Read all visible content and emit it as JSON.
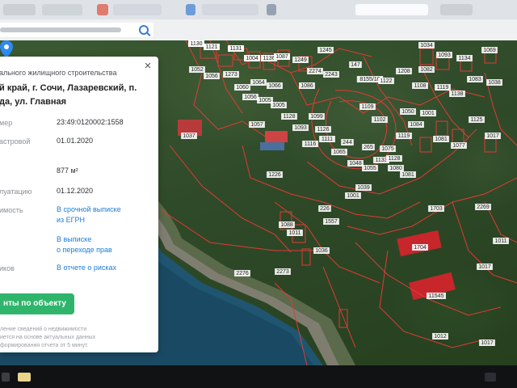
{
  "browser": {
    "search_icon": "search-icon"
  },
  "card": {
    "title_line1": "ального жилищного строительства",
    "title_line2": "й край, г. Сочи, Лазаревский, п.",
    "title_line3": "да, ул. Главная",
    "rows": [
      {
        "label": "мер",
        "value": "23:49:0120002:1558"
      },
      {
        "label": "астровой",
        "value": "01.01.2020"
      },
      {
        "label": "",
        "value": "877 м²"
      },
      {
        "label": "луатацию",
        "value": "01.12.2020"
      },
      {
        "label": "имость",
        "value": "В срочной выписке",
        "value2": "из ЕГРН"
      },
      {
        "label": "",
        "value": "В выписке",
        "value2": "о переходе прав"
      },
      {
        "label": "иков",
        "value": "В отчете о рисках"
      }
    ],
    "button_label": "нты по объекту",
    "footer_line1": "ление сведений о недвижимости",
    "footer_line2": "иется на основе актуальных данных",
    "footer_line3": "формирования отчета от 5 минут.",
    "close_label": "×"
  },
  "map": {
    "parcel_labels": [
      "1116",
      "1115",
      "1062",
      "1063",
      "1064",
      "1128",
      "1249",
      "1245",
      "1034",
      "1093",
      "1134",
      "1069",
      "1052",
      "1056",
      "1273",
      "1060",
      "1064",
      "1066",
      "1086",
      "1109",
      "1102",
      "1108",
      "1082",
      "1037",
      "1057",
      "244",
      "265",
      "1075",
      "1119",
      "1084",
      "1080",
      "1081",
      "1226",
      "226",
      "1557",
      "1001",
      "1039",
      "1036",
      "1088",
      "1011",
      "1703",
      "1704",
      "11545",
      "1012",
      "1017",
      "1017",
      "1017",
      "1011",
      "2269",
      "2273",
      "2276",
      "2274",
      "2243",
      "147",
      "8155/10",
      "1122",
      "1208",
      "1119",
      "1138",
      "1083",
      "1038",
      "1099",
      "1126",
      "1111",
      "1065",
      "1048",
      "1055",
      "1133",
      "1128",
      "1050",
      "1001",
      "1081",
      "1077",
      "1125",
      "1116",
      "1093",
      "1128",
      "1005",
      "1005",
      "1056",
      "1130",
      "1121",
      "1131",
      "1004",
      "1136",
      "1087"
    ],
    "pin_icon": "map-pin-icon"
  }
}
